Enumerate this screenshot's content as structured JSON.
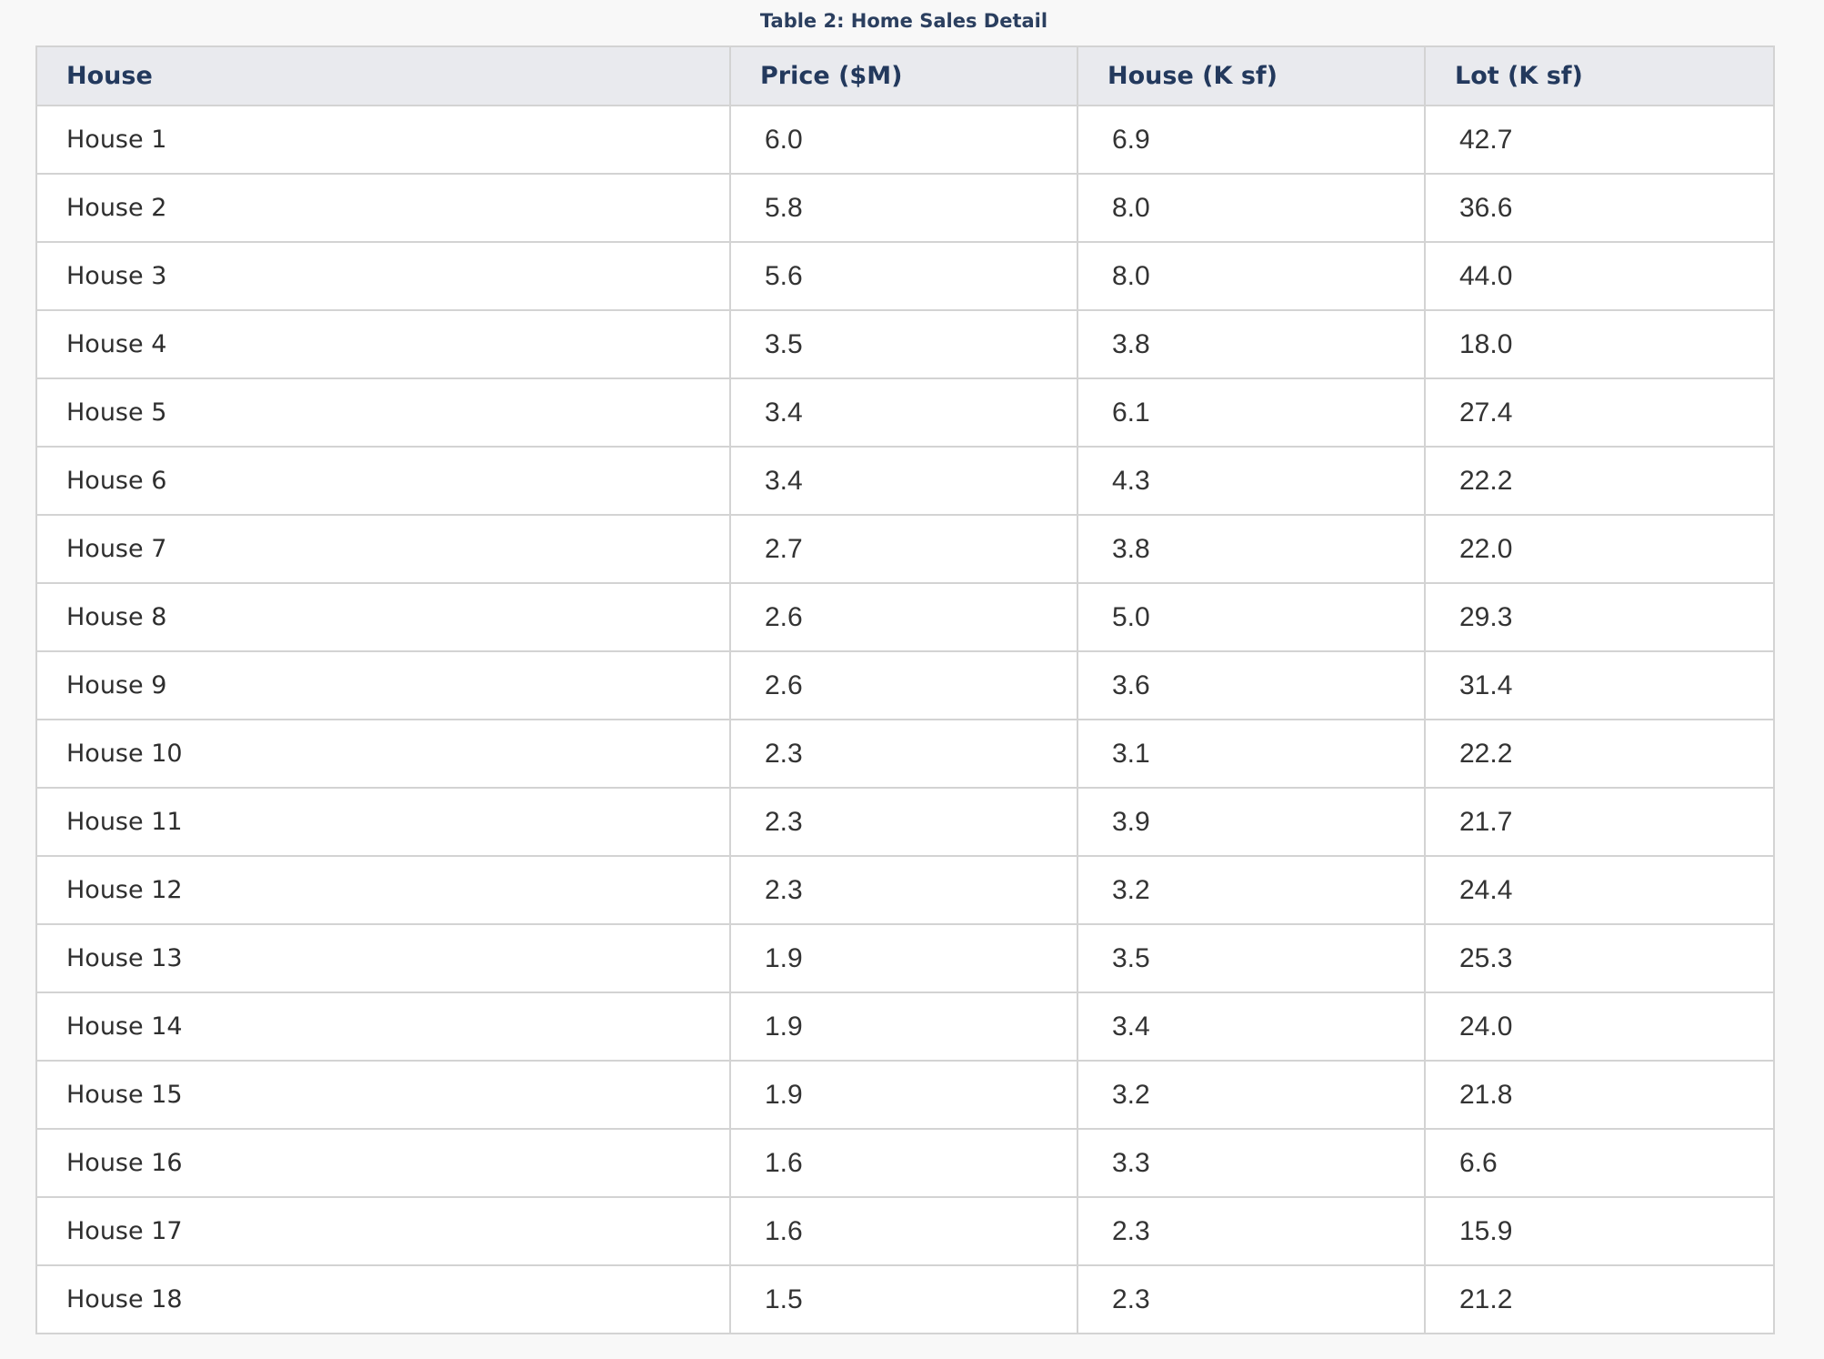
{
  "title": "Table 2: Home Sales Detail",
  "table": {
    "columns": [
      "House",
      "Price ($M)",
      "House (K sf)",
      "Lot (K sf)"
    ],
    "rows": [
      [
        "House 1",
        "6.0",
        "6.9",
        "42.7"
      ],
      [
        "House 2",
        "5.8",
        "8.0",
        "36.6"
      ],
      [
        "House 3",
        "5.6",
        "8.0",
        "44.0"
      ],
      [
        "House 4",
        "3.5",
        "3.8",
        "18.0"
      ],
      [
        "House 5",
        "3.4",
        "6.1",
        "27.4"
      ],
      [
        "House 6",
        "3.4",
        "4.3",
        "22.2"
      ],
      [
        "House 7",
        "2.7",
        "3.8",
        "22.0"
      ],
      [
        "House 8",
        "2.6",
        "5.0",
        "29.3"
      ],
      [
        "House 9",
        "2.6",
        "3.6",
        "31.4"
      ],
      [
        "House 10",
        "2.3",
        "3.1",
        "22.2"
      ],
      [
        "House 11",
        "2.3",
        "3.9",
        "21.7"
      ],
      [
        "House 12",
        "2.3",
        "3.2",
        "24.4"
      ],
      [
        "House 13",
        "1.9",
        "3.5",
        "25.3"
      ],
      [
        "House 14",
        "1.9",
        "3.4",
        "24.0"
      ],
      [
        "House 15",
        "1.9",
        "3.2",
        "21.8"
      ],
      [
        "House 16",
        "1.6",
        "3.3",
        "6.6"
      ],
      [
        "House 17",
        "1.6",
        "2.3",
        "15.9"
      ],
      [
        "House 18",
        "1.5",
        "2.3",
        "21.2"
      ]
    ]
  },
  "colors": {
    "header_bg": "#e9eaee",
    "header_text": "#23395d",
    "border": "#d3d3d3",
    "page_bg": "#f8f8f8"
  }
}
